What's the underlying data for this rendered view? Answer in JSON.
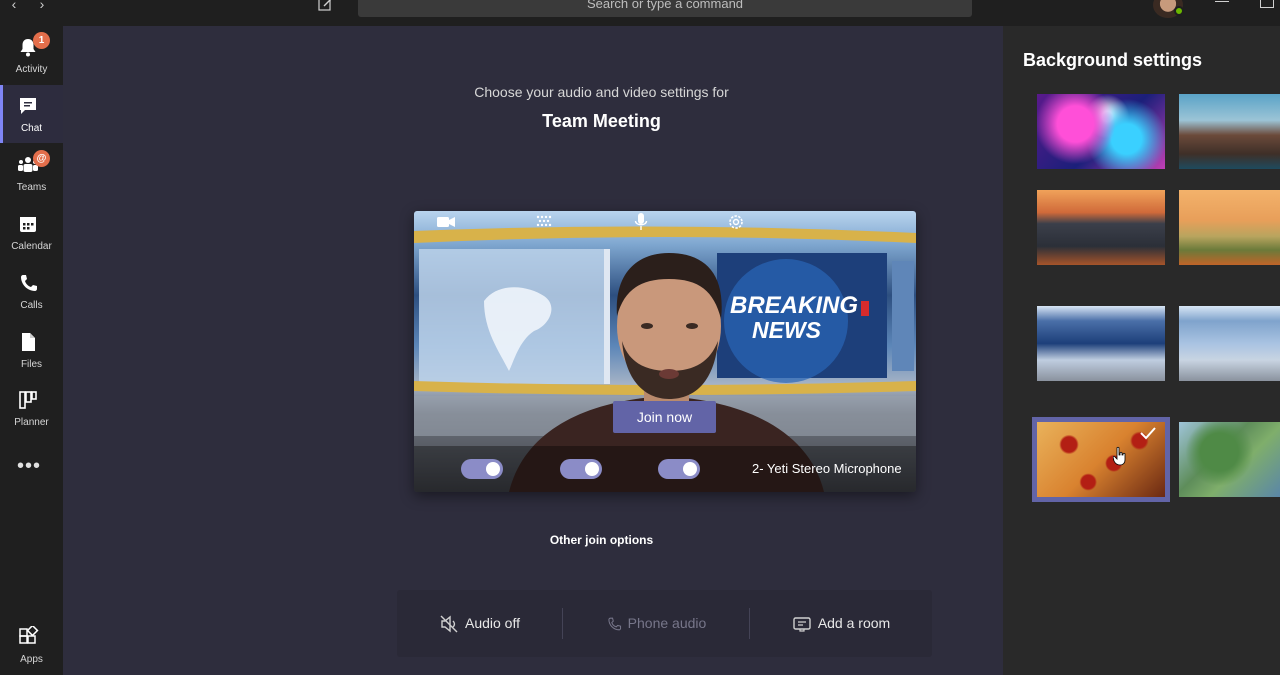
{
  "topbar": {
    "search_placeholder": "Search or type a command",
    "back_icon": "chevron-left-icon",
    "forward_icon": "chevron-right-icon",
    "compose_icon": "compose-icon"
  },
  "rail": {
    "items": [
      {
        "label": "Activity",
        "icon": "bell-icon",
        "badge": "1"
      },
      {
        "label": "Chat",
        "icon": "chat-icon",
        "active": true
      },
      {
        "label": "Teams",
        "icon": "teams-icon",
        "badge": "@"
      },
      {
        "label": "Calendar",
        "icon": "calendar-icon"
      },
      {
        "label": "Calls",
        "icon": "phone-icon"
      },
      {
        "label": "Files",
        "icon": "file-icon"
      },
      {
        "label": "Planner",
        "icon": "planner-icon"
      }
    ],
    "more": "•••",
    "apps": {
      "label": "Apps",
      "icon": "apps-icon"
    }
  },
  "main": {
    "choose_text": "Choose your audio and video settings for",
    "meeting_title": "Team Meeting",
    "preview": {
      "join_button": "Join now",
      "camera_on": true,
      "blur_on": true,
      "mic_on": true,
      "mic_device": "2- Yeti Stereo Microphone",
      "background_text_1": "BREAKING",
      "background_text_2": "NEWS"
    },
    "other_title": "Other join options",
    "options": [
      {
        "label": "Audio off",
        "icon": "speaker-off-icon",
        "enabled": true
      },
      {
        "label": "Phone audio",
        "icon": "phone-icon",
        "enabled": false
      },
      {
        "label": "Add a room",
        "icon": "room-icon",
        "enabled": true
      }
    ]
  },
  "background_panel": {
    "title": "Background settings",
    "thumbnails": [
      {
        "name": "galaxy",
        "selected": false
      },
      {
        "name": "coastal-cliffs",
        "selected": false
      },
      {
        "name": "autumn-street",
        "selected": false
      },
      {
        "name": "autumn-landscape",
        "selected": false
      },
      {
        "name": "news-studio-1",
        "selected": false
      },
      {
        "name": "news-studio-2",
        "selected": false
      },
      {
        "name": "pizza",
        "selected": true
      },
      {
        "name": "map",
        "selected": false
      }
    ]
  },
  "colors": {
    "accent": "#6264a7",
    "badge": "#e36e4b",
    "presence": "#6bb700",
    "main_bg": "#2e2d3d",
    "rail_bg": "#1f1f1f",
    "panel_bg": "#292929"
  }
}
